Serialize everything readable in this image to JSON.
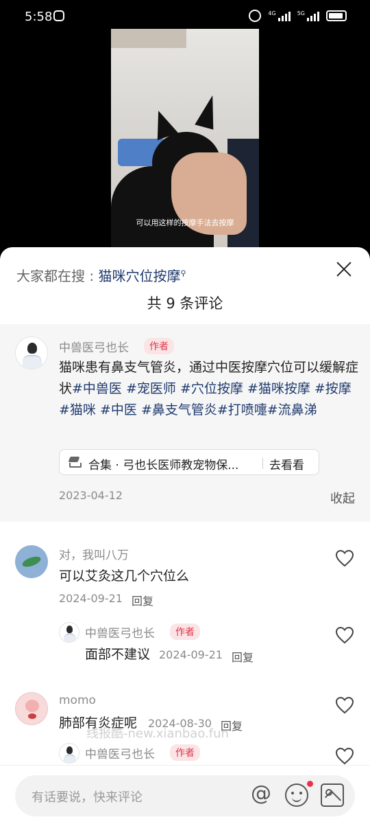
{
  "status_bar": {
    "time": "5:58",
    "signal1": "4G",
    "signal2": "5G"
  },
  "video": {
    "subtitle": "可以用这样的按摩手法去按摩"
  },
  "comments_sheet": {
    "search_prefix": "大家都在搜 : ",
    "search_term": "猫咪穴位按摩",
    "title": "共 9 条评论",
    "author_post": {
      "username": "中兽医弓也长",
      "badge": "作者",
      "text": "猫咪患有鼻支气管炎，通过中医按摩穴位可以缓解症状",
      "tags": [
        "#中兽医",
        "#宠医师",
        "#穴位按摩",
        "#猫咪按摩",
        "#按摩",
        "#猫咪",
        "#中医",
        "#鼻支气管炎",
        "#打喷嚏",
        "#流鼻涕"
      ],
      "collection_label": "合集 · 弓也长医师教宠物保...",
      "collection_action": "去看看",
      "date": "2023-04-12",
      "collapse_label": "收起"
    },
    "comments": [
      {
        "username": "对，我叫八万",
        "text": "可以艾灸这几个穴位么",
        "date": "2024-09-21",
        "reply_label": "回复",
        "replies": [
          {
            "username": "中兽医弓也长",
            "badge": "作者",
            "text": "面部不建议",
            "date": "2024-09-21",
            "reply_label": "回复"
          }
        ]
      },
      {
        "username": "momo",
        "text": "肺部有炎症呢",
        "date": "2024-08-30",
        "reply_label": "回复",
        "replies": [
          {
            "username": "中兽医弓也长",
            "badge": "作者"
          }
        ]
      }
    ],
    "watermark": "线报酷-new.xianbao.fun",
    "input_placeholder": "有话要说，快来评论",
    "at_symbol": "@"
  }
}
